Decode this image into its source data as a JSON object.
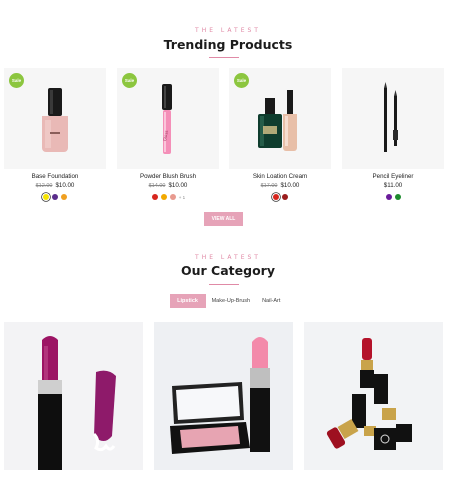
{
  "trending": {
    "subtitle": "THE LATEST",
    "title": "Trending Products",
    "products": [
      {
        "name": "Base Foundation",
        "old_price": "$12.00",
        "price": "$10.00",
        "badge": "Sale",
        "swatches": [
          "#f5e400",
          "#5a2d8c",
          "#f0a020"
        ],
        "more": ""
      },
      {
        "name": "Powder Blush Brush",
        "old_price": "$14.00",
        "price": "$10.00",
        "badge": "Sale",
        "swatches": [
          "#d7261e",
          "#f2a900",
          "#e89a8f"
        ],
        "more": "+ 1"
      },
      {
        "name": "Skin Loation Cream",
        "old_price": "$17.00",
        "price": "$10.00",
        "badge": "Sale",
        "swatches": [
          "#d7261e",
          "#9b1c1c"
        ],
        "more": ""
      },
      {
        "name": "Pencil Eyeliner",
        "old_price": "",
        "price": "$11.00",
        "badge": "",
        "swatches": [
          "#6a1b9a",
          "#1e8b2e"
        ],
        "more": ""
      }
    ],
    "view_all": "VIEW ALL"
  },
  "category": {
    "subtitle": "THE LATEST",
    "title": "Our Category",
    "tabs": [
      "Lipstick",
      "Make-Up-Brush",
      "Nail-Art"
    ],
    "active_tab": "Lipstick"
  },
  "colors": {
    "accent": "#e6a3b8",
    "sale_badge": "#8cc63f"
  }
}
